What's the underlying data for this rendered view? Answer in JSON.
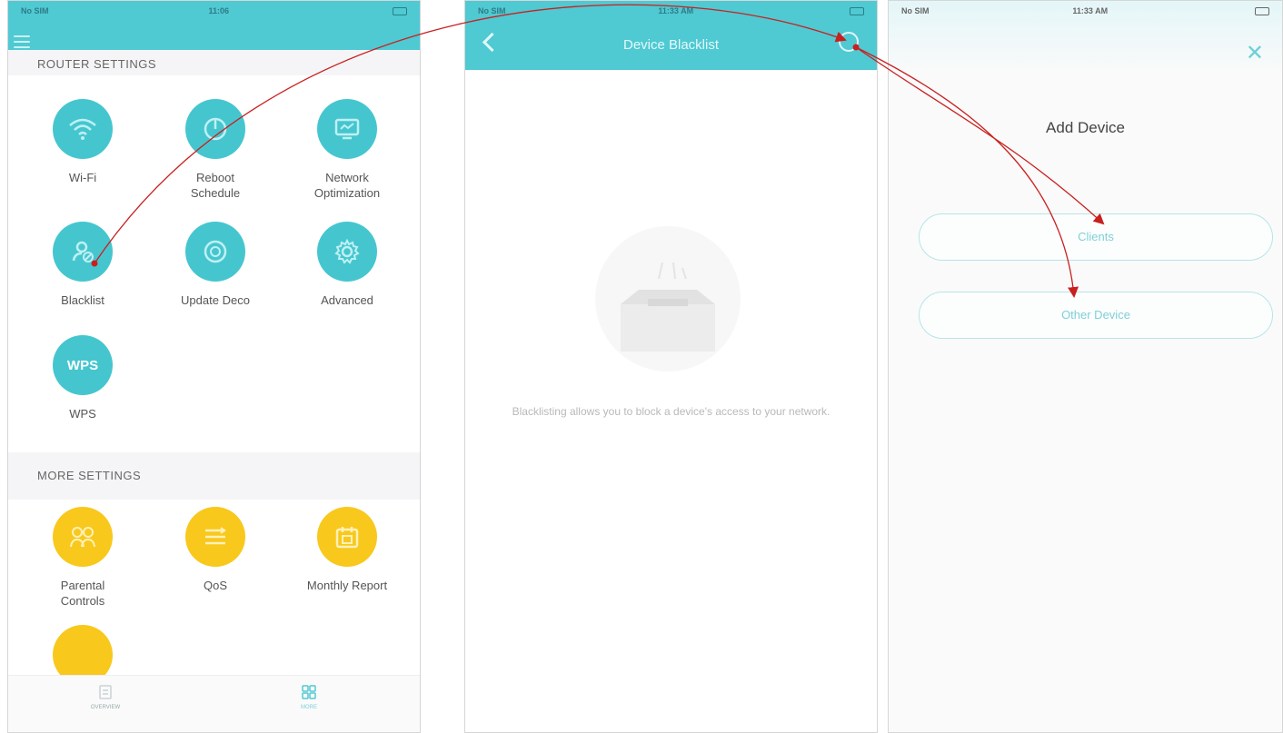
{
  "panel1": {
    "status": {
      "carrier": "No SIM",
      "time": "11:06"
    },
    "router_settings_title": "ROUTER SETTINGS",
    "router_items": [
      {
        "label": "Wi-Fi",
        "icon": "wifi-icon"
      },
      {
        "label": "Reboot Schedule",
        "icon": "power-icon"
      },
      {
        "label": "Network Optimization",
        "icon": "monitor-icon"
      },
      {
        "label": "Blacklist",
        "icon": "block-user-icon"
      },
      {
        "label": "Update Deco",
        "icon": "update-icon"
      },
      {
        "label": "Advanced",
        "icon": "gear-icon"
      },
      {
        "label": "WPS",
        "icon": "wps-icon",
        "icon_text": "WPS"
      }
    ],
    "more_settings_title": "MORE SETTINGS",
    "more_items": [
      {
        "label": "Parental Controls",
        "icon": "parental-icon"
      },
      {
        "label": "QoS",
        "icon": "qos-icon"
      },
      {
        "label": "Monthly Report",
        "icon": "calendar-icon"
      }
    ],
    "tabs": [
      {
        "label": "OVERVIEW",
        "icon": "overview-icon"
      },
      {
        "label": "MORE",
        "icon": "grid-icon"
      }
    ]
  },
  "panel2": {
    "status": {
      "carrier": "No SIM",
      "time": "11:33 AM"
    },
    "title": "Device Blacklist",
    "empty_text": "Blacklisting allows you to block a device's access to your network."
  },
  "panel3": {
    "status": {
      "carrier": "No SIM",
      "time": "11:33 AM"
    },
    "title": "Add Device",
    "options": [
      "Clients",
      "Other Device"
    ]
  },
  "colors": {
    "teal": "#4fc9d2",
    "yellow": "#f8c81c",
    "arrow": "#c8201f"
  }
}
